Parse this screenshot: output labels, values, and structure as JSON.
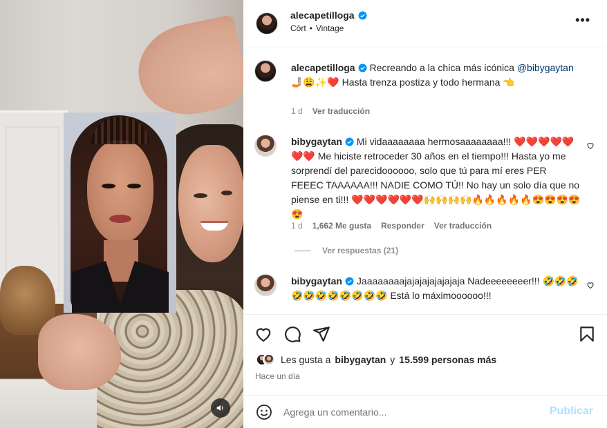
{
  "post": {
    "username": "alecapetilloga",
    "audio": "Cōrt",
    "separator": "•",
    "audio_tag": "Vintage",
    "more": "•••"
  },
  "caption": {
    "username": "alecapetilloga",
    "text": "Recreando a la chica más icónica",
    "mention": "@bibygaytan",
    "text2": "🤳🏼😩✨❤️ Hasta trenza postiza y todo hermana 👈",
    "time": "1 d",
    "translate": "Ver traducción"
  },
  "comment1": {
    "username": "bibygaytan",
    "text": "Mi vidaaaaaaaa hermosaaaaaaaa!!! ❤️❤️❤️❤️❤️❤️❤️ Me hiciste retroceder 30 años en el tiempo!!! Hasta yo me sorprendí del parecidoooooo, solo que tú para mí eres PER FEEEC TAAAAAA!!! NADIE COMO TÚ!! No hay un solo día que no piense en ti!!! ❤️❤️❤️❤️❤️❤️🙌🙌🙌🙌🔥🔥🔥🔥🔥😍😍😍😍😍",
    "time": "1 d",
    "likes": "1,662 Me gusta",
    "reply": "Responder",
    "translate": "Ver traducción",
    "view_replies": "Ver respuestas (21)"
  },
  "comment2": {
    "username": "bibygaytan",
    "text": "Jaaaaaaaajajajajajajajaja Nadeeeeeeeer!!! 🤣🤣🤣🤣🤣🤣🤣🤣🤣🤣🤣 Está lo máximoooooo!!!"
  },
  "likes_line": {
    "prefix": "Les gusta a",
    "user": "bibygaytan",
    "middle": "y",
    "count": "15.599 personas más"
  },
  "posted": "Hace un día",
  "comment_input": {
    "placeholder": "Agrega un comentario..."
  },
  "publish_label": "Publicar",
  "colors": {
    "verified": "#0095f6",
    "link": "#00376b",
    "publish_disabled": "#b2dffc"
  },
  "icons": [
    "verified-icon",
    "more-icon",
    "heart-icon",
    "comment-icon",
    "share-icon",
    "save-icon",
    "emoji-icon",
    "volume-icon"
  ]
}
